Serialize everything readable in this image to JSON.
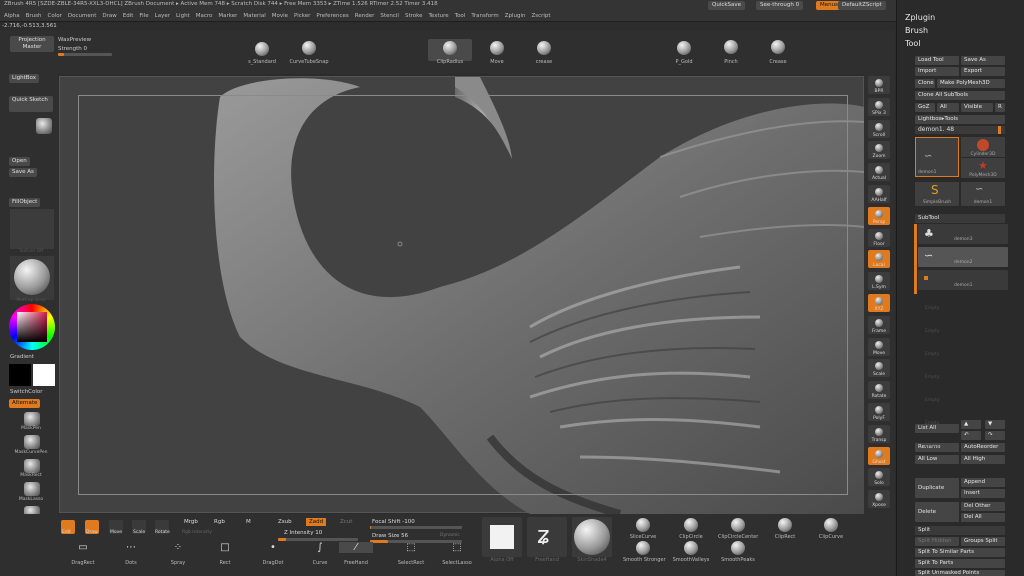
{
  "menubar": {
    "title_line": "ZBrush 4R5 [SZDE-ZBLE-34R5-XXL3-DHCL]   ZBrush Document   ▸ Active Mem 748 ▸ Scratch Disk 744 ▸ Free Mem 3353 ▸ ZTime 1.526 RTimer 2.52 Timer 3.418",
    "quicksave": "QuickSave",
    "see_through": "See-through  0",
    "menus_btn": "Menus",
    "default_script": "DefaultZScript",
    "menus": [
      "Alpha",
      "Brush",
      "Color",
      "Document",
      "Draw",
      "Edit",
      "File",
      "Layer",
      "Light",
      "Macro",
      "Marker",
      "Material",
      "Movie",
      "Picker",
      "Preferences",
      "Render",
      "Stencil",
      "Stroke",
      "Texture",
      "Tool",
      "Transform",
      "Zplugin",
      "Zscript"
    ]
  },
  "coords": "-2.716,-0.513,3.561",
  "top_shelf": {
    "projection_master": "Projection Master",
    "wax_preview": "WaxPreview",
    "strength_label": "Strength 0",
    "strength_value": 0,
    "brushes": [
      {
        "name": "s_Standard"
      },
      {
        "name": "CurveTubeSnap"
      },
      {
        "name": "ClipRadius"
      },
      {
        "name": "Move"
      },
      {
        "name": "crease"
      },
      {
        "name": "P_Gold"
      },
      {
        "name": "Pinch"
      },
      {
        "name": "Crease"
      }
    ]
  },
  "left_shelf": {
    "lightbox": "LightBox",
    "quick_sketch": "Quick Sketch",
    "open": "Open",
    "save_as": "Save As",
    "fill_object": "FillObject",
    "texture_off": "Texture Off",
    "material_name": "MatCap Gray",
    "gradient": "Gradient",
    "switch_color": "SwitchColor",
    "alternate": "Alternate",
    "brush_shelf": [
      "MaskPen",
      "MaskCurvePen",
      "MaskRect",
      "MaskLasso",
      "MaskCircle",
      "MaskCurve"
    ]
  },
  "right_shelf": [
    {
      "label": "BPR",
      "on": false
    },
    {
      "label": "SPix 3",
      "on": false
    },
    {
      "label": "Scroll",
      "on": false
    },
    {
      "label": "Zoom",
      "on": false
    },
    {
      "label": "Actual",
      "on": false
    },
    {
      "label": "AAHalf",
      "on": false
    },
    {
      "label": "Persp",
      "on": true
    },
    {
      "label": "Floor",
      "on": false
    },
    {
      "label": "Local",
      "on": true
    },
    {
      "label": "L.Sym",
      "on": false
    },
    {
      "label": "XYZ",
      "on": true
    },
    {
      "label": "Frame",
      "on": false
    },
    {
      "label": "Move",
      "on": false
    },
    {
      "label": "Scale",
      "on": false
    },
    {
      "label": "Rotate",
      "on": false
    },
    {
      "label": "PolyF",
      "on": false
    },
    {
      "label": "Transp",
      "on": false
    },
    {
      "label": "Ghost",
      "on": true
    },
    {
      "label": "Solo",
      "on": false
    },
    {
      "label": "Xpose",
      "on": false
    }
  ],
  "tray": {
    "zplugin": "Zplugin",
    "brush": "Brush",
    "tool": "Tool",
    "load_tool": "Load Tool",
    "save_as": "Save As",
    "import": "Import",
    "export": "Export",
    "clone": "Clone",
    "make_polymesh": "Make PolyMesh3D",
    "clone_all_subtools": "Clone All SubTools",
    "goz": "GoZ",
    "all": "All",
    "visible": "Visible",
    "r": "R",
    "lightbox_tools": "Lightbox▸Tools",
    "demon_slider": "demon1. 48",
    "thumbs": [
      {
        "name": "demon1"
      },
      {
        "name": "Cylinder3D"
      },
      {
        "name": "PolyMesh3D"
      },
      {
        "name": "SimpleBrush"
      },
      {
        "name": "demon1"
      }
    ],
    "subtool_header": "SubTool",
    "subtools": [
      {
        "name": "demon3",
        "active": false
      },
      {
        "name": "demon2",
        "active": true
      },
      {
        "name": "demon1",
        "active": false
      }
    ],
    "empty_slots": [
      "Empty",
      "Empty",
      "Empty",
      "Empty",
      "Empty",
      "Empty",
      "Empty"
    ],
    "list_all": "List All",
    "rename": "Rename",
    "auto_reorder": "AutoReorder",
    "all_low": "All Low",
    "all_high": "All High",
    "duplicate": "Duplicate",
    "append": "Append",
    "insert": "Insert",
    "delete": "Delete",
    "del_other": "Del Other",
    "del_all": "Del All",
    "split": "Split",
    "split_hidden": "Split Hidden",
    "groups_split": "Groups Split",
    "split_unmasked": "Split To Similar Parts",
    "split_to_parts": "Split To Parts",
    "split_masked": "Split Unmasked Points"
  },
  "bottom_shelf": {
    "edit": "Edit",
    "draw": "Draw",
    "move": "Move",
    "scale": "Scale",
    "rotate": "Rotate",
    "mrgb": "Mrgb",
    "rgb": "Rgb",
    "m": "M",
    "zsub": "Zsub",
    "zadd": "Zadd",
    "zcut": "Zcut",
    "rgb_intensity": "Rgb Intensity",
    "z_intensity_label": "Z Intensity 10",
    "z_intensity_value": 10,
    "focal_shift_label": "Focal Shift -100",
    "focal_shift_value": -100,
    "draw_size_label": "Draw Size 56",
    "draw_size_value": 56,
    "dynamic": "Dynamic",
    "strokes": [
      "DragRect",
      "Dots",
      "Spray",
      "Rect",
      "DragDot",
      "Curve",
      "FreeHand",
      "SelectRect",
      "SelectLasso"
    ],
    "clip_brushes": [
      "SliceCurve",
      "ClipCircle",
      "ClipCircleCenter",
      "ClipRect",
      "ClipCurve"
    ],
    "smooth_brushes": [
      "Smooth Stronger",
      "SmoothValleys",
      "SmoothPeaks"
    ],
    "alpha_label": "Alpha Off",
    "stroke_label": "FreeHand",
    "material_label": "SkinShade4"
  },
  "colors": {
    "accent": "#e07a1f",
    "panel": "#2f2f2f",
    "canvas": "#424242",
    "button": "#4a4a4a"
  }
}
